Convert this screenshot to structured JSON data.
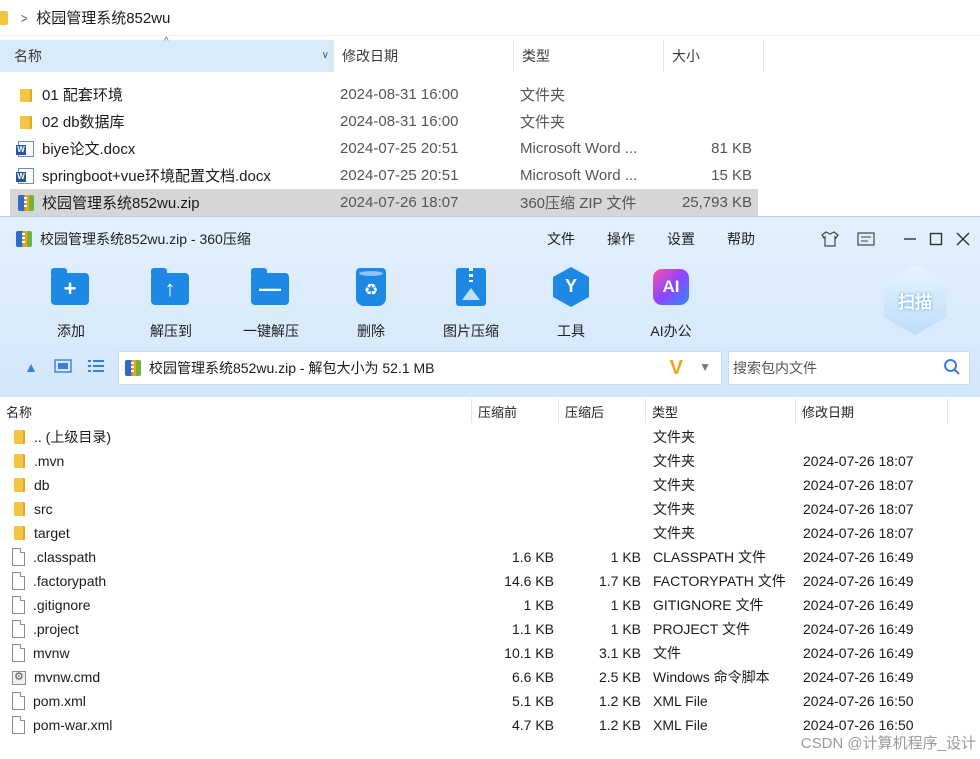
{
  "explorer": {
    "breadcrumb": "校园管理系统852wu",
    "columns": {
      "name": "名称",
      "date": "修改日期",
      "type": "类型",
      "size": "大小"
    },
    "rows": [
      {
        "name": "01 配套环境",
        "date": "2024-08-31 16:00",
        "type": "文件夹",
        "size": "",
        "icon": "folder-icon"
      },
      {
        "name": "02 db数据库",
        "date": "2024-08-31 16:00",
        "type": "文件夹",
        "size": "",
        "icon": "folder-icon"
      },
      {
        "name": "biye论文.docx",
        "date": "2024-07-25 20:51",
        "type": "Microsoft Word ...",
        "size": "81 KB",
        "icon": "word-doc-icon"
      },
      {
        "name": "springboot+vue环境配置文档.docx",
        "date": "2024-07-25 20:51",
        "type": "Microsoft Word ...",
        "size": "15 KB",
        "icon": "word-doc-icon"
      },
      {
        "name": "校园管理系统852wu.zip",
        "date": "2024-07-26 18:07",
        "type": "360压缩 ZIP 文件",
        "size": "25,793 KB",
        "icon": "zip-icon"
      }
    ]
  },
  "zip": {
    "title": "校园管理系统852wu.zip - 360压缩",
    "menu": [
      "文件",
      "操作",
      "设置",
      "帮助"
    ],
    "toolbar": {
      "add": "添加",
      "extract_to": "解压到",
      "one_click_extract": "一键解压",
      "delete": "删除",
      "image_compress": "图片压缩",
      "tools": "工具",
      "ai_office": "AI办公",
      "scan": "扫描"
    },
    "address": "校园管理系统852wu.zip - 解包大小为 52.1 MB",
    "search_placeholder": "搜索包内文件",
    "columns": {
      "name": "名称",
      "original": "压缩前",
      "compressed": "压缩后",
      "type": "类型",
      "date": "修改日期"
    },
    "rows": [
      {
        "name": ".. (上级目录)",
        "original": "",
        "compressed": "",
        "type": "文件夹",
        "date": "",
        "icon": "folder-icon"
      },
      {
        "name": ".mvn",
        "original": "",
        "compressed": "",
        "type": "文件夹",
        "date": "2024-07-26 18:07",
        "icon": "folder-icon"
      },
      {
        "name": "db",
        "original": "",
        "compressed": "",
        "type": "文件夹",
        "date": "2024-07-26 18:07",
        "icon": "folder-icon"
      },
      {
        "name": "src",
        "original": "",
        "compressed": "",
        "type": "文件夹",
        "date": "2024-07-26 18:07",
        "icon": "folder-icon"
      },
      {
        "name": "target",
        "original": "",
        "compressed": "",
        "type": "文件夹",
        "date": "2024-07-26 18:07",
        "icon": "folder-icon"
      },
      {
        "name": ".classpath",
        "original": "1.6 KB",
        "compressed": "1 KB",
        "type": "CLASSPATH 文件",
        "date": "2024-07-26 16:49",
        "icon": "file-icon"
      },
      {
        "name": ".factorypath",
        "original": "14.6 KB",
        "compressed": "1.7 KB",
        "type": "FACTORYPATH 文件",
        "date": "2024-07-26 16:49",
        "icon": "file-icon"
      },
      {
        "name": ".gitignore",
        "original": "1 KB",
        "compressed": "1 KB",
        "type": "GITIGNORE 文件",
        "date": "2024-07-26 16:49",
        "icon": "file-icon"
      },
      {
        "name": ".project",
        "original": "1.1 KB",
        "compressed": "1 KB",
        "type": "PROJECT 文件",
        "date": "2024-07-26 16:49",
        "icon": "file-icon"
      },
      {
        "name": "mvnw",
        "original": "10.1 KB",
        "compressed": "3.1 KB",
        "type": "文件",
        "date": "2024-07-26 16:49",
        "icon": "file-icon"
      },
      {
        "name": "mvnw.cmd",
        "original": "6.6 KB",
        "compressed": "2.5 KB",
        "type": "Windows 命令脚本",
        "date": "2024-07-26 16:49",
        "icon": "cmd-script-icon"
      },
      {
        "name": "pom.xml",
        "original": "5.1 KB",
        "compressed": "1.2 KB",
        "type": "XML File",
        "date": "2024-07-26 16:50",
        "icon": "file-icon"
      },
      {
        "name": "pom-war.xml",
        "original": "4.7 KB",
        "compressed": "1.2 KB",
        "type": "XML File",
        "date": "2024-07-26 16:50",
        "icon": "file-icon"
      }
    ]
  },
  "watermark": "CSDN @计算机程序_设计",
  "colors": {
    "accent": "#1e88e5",
    "selected_row": "#d6d6d6",
    "header_active": "#d9ebf9"
  }
}
